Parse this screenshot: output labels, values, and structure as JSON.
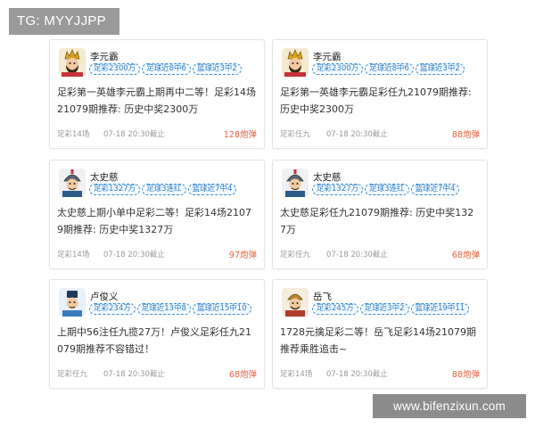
{
  "tg_label": "TG: MYYJJPP",
  "watermark": "www.bifenzixun.com",
  "colors": {
    "tag_border": "#3d8fd6",
    "price": "#e8613c",
    "watermark_bg": "#8c8c8c"
  },
  "cards": [
    {
      "avatar_icon": "king-avatar-icon",
      "name": "李元霸",
      "tags": [
        "足彩2300万",
        "足球近8中6",
        "篮球近3中2"
      ],
      "content": "足彩第一英雄李元霸上期再中二等！足彩14场21079期推荐: 历史中奖2300万",
      "category": "足彩14场",
      "time": "07-18 20:30截止",
      "price": "128炮弹"
    },
    {
      "avatar_icon": "king-avatar-icon",
      "name": "李元霸",
      "tags": [
        "足彩2300万",
        "足球近8中6",
        "篮球近3中2"
      ],
      "content": "足彩第一英雄李元霸足彩任九21079期推荐: 历史中奖2300万",
      "category": "足彩任九",
      "time": "07-18 20:30截止",
      "price": "88炮弹"
    },
    {
      "avatar_icon": "warrior-avatar-icon",
      "name": "太史慈",
      "tags": [
        "足彩1327万",
        "足球3连红",
        "篮球近7中4"
      ],
      "content": "太史慈上期小单中足彩二等！足彩14场21079期推荐: 历史中奖1327万",
      "category": "足彩14场",
      "time": "07-18 20:30截止",
      "price": "97炮弹"
    },
    {
      "avatar_icon": "warrior-avatar-icon",
      "name": "太史慈",
      "tags": [
        "足彩1327万",
        "足球3连红",
        "篮球近7中4"
      ],
      "content": "太史慈足彩任九21079期推荐: 历史中奖1327万",
      "category": "足彩任九",
      "time": "07-18 20:30截止",
      "price": "68炮弹"
    },
    {
      "avatar_icon": "scholar-avatar-icon",
      "name": "卢俊义",
      "tags": [
        "足彩234万",
        "足球近13中8",
        "篮球近15中10"
      ],
      "content": "上期中56注任九揽27万！卢俊义足彩任九21079期推荐不容错过！",
      "category": "足彩任九",
      "time": "07-18 20:30截止",
      "price": "68炮弹"
    },
    {
      "avatar_icon": "general-avatar-icon",
      "name": "岳飞",
      "tags": [
        "足彩245万",
        "足球近3中2",
        "篮球近19中11"
      ],
      "content": "1728元擒足彩二等！岳飞足彩14场21079期推荐乘胜追击~",
      "category": "足彩14场",
      "time": "07-18 20:30截止",
      "price": "88炮弹"
    }
  ]
}
